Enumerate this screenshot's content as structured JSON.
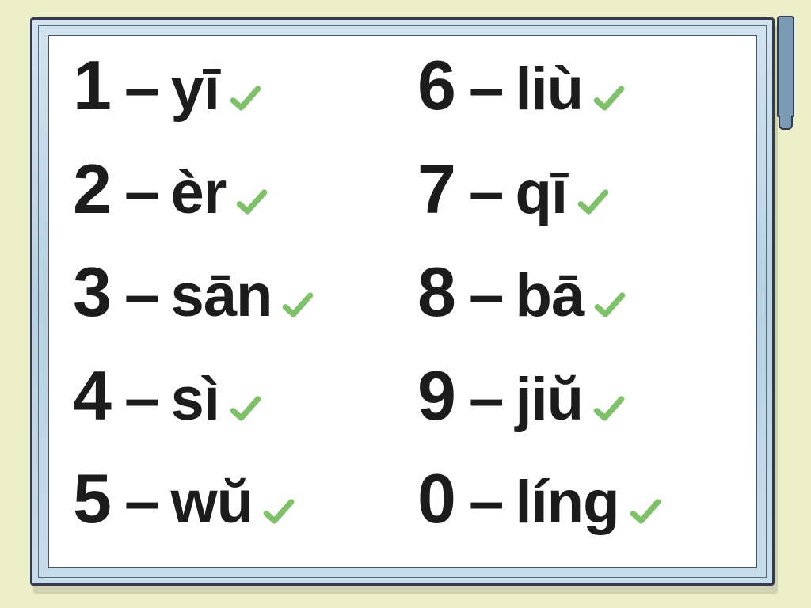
{
  "left": [
    {
      "num": "1",
      "dash": "–",
      "pinyin": "yī"
    },
    {
      "num": "2",
      "dash": "–",
      "pinyin": "èr"
    },
    {
      "num": "3",
      "dash": "–",
      "pinyin": "sān"
    },
    {
      "num": "4",
      "dash": "–",
      "pinyin": "sì"
    },
    {
      "num": "5",
      "dash": "–",
      "pinyin": "wŭ"
    }
  ],
  "right": [
    {
      "num": "6",
      "dash": "–",
      "pinyin": "liù"
    },
    {
      "num": "7",
      "dash": "–",
      "pinyin": "qī"
    },
    {
      "num": "8",
      "dash": "–",
      "pinyin": "bā"
    },
    {
      "num": "9",
      "dash": "–",
      "pinyin": "jiŭ"
    },
    {
      "num": "0",
      "dash": "–",
      "pinyin": "líng"
    }
  ],
  "colors": {
    "background": "#ebf0c9",
    "frame": "#b7d2e3",
    "outline": "#353a52",
    "check": "#7fc169",
    "text": "#1c1c1c"
  }
}
